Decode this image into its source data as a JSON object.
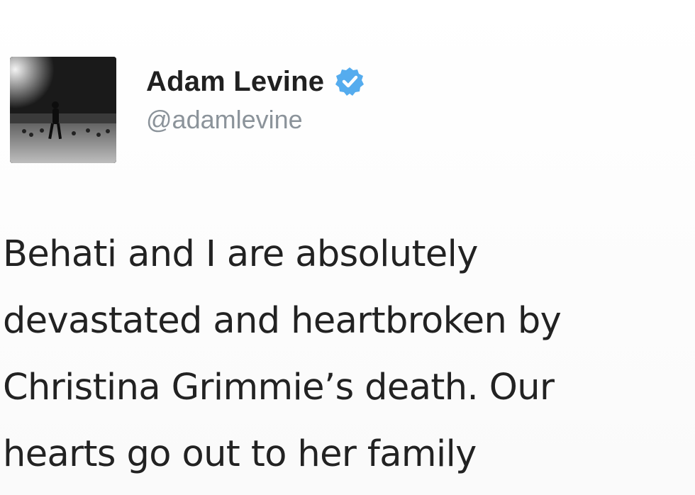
{
  "tweet": {
    "display_name": "Adam Levine",
    "handle": "@adamlevine",
    "verified": true,
    "verified_color": "#55acee",
    "text": "Behati and I are absolutely\ndevastated and heartbroken by\nChristina Grimmie’s death. Our\nhearts go out to her family"
  },
  "icons": {
    "avatar": "profile-photo",
    "verified": "verified-badge-icon"
  }
}
